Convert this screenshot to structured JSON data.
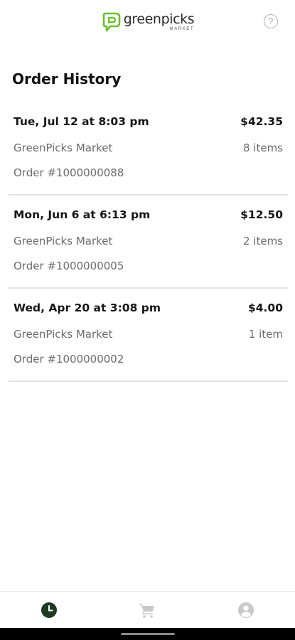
{
  "header": {
    "logo_word": "greenpicks",
    "logo_sub": "MARKET",
    "help_symbol": "?",
    "brand_color": "#6bbf2b"
  },
  "page": {
    "title": "Order History"
  },
  "orders": [
    {
      "datetime": "Tue, Jul 12 at 8:03 pm",
      "total": "$42.35",
      "store": "GreenPicks Market",
      "items": "8 items",
      "order_number": "Order #1000000088"
    },
    {
      "datetime": "Mon, Jun 6 at 6:13 pm",
      "total": "$12.50",
      "store": "GreenPicks Market",
      "items": "2 items",
      "order_number": "Order #1000000005"
    },
    {
      "datetime": "Wed, Apr 20 at 3:08 pm",
      "total": "$4.00",
      "store": "GreenPicks Market",
      "items": "1 item",
      "order_number": "Order #1000000002"
    }
  ],
  "bottom_nav": {
    "items": [
      {
        "icon": "clock-icon",
        "active": true
      },
      {
        "icon": "cart-icon",
        "active": false
      },
      {
        "icon": "profile-icon",
        "active": false
      }
    ],
    "active_color": "#1f3a22",
    "inactive_color": "#c9c9c9"
  }
}
